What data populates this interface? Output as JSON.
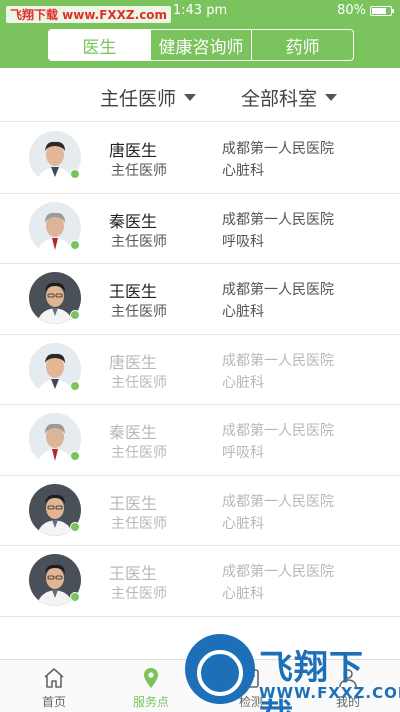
{
  "status_bar": {
    "watermark": "飞翔下载 www.FXXZ.com",
    "time": "1:43 pm",
    "battery": "80%",
    "battery_level": 0.8
  },
  "segments": [
    {
      "label": "医生",
      "active": true
    },
    {
      "label": "健康咨询师",
      "active": false
    },
    {
      "label": "药师",
      "active": false
    }
  ],
  "filters": {
    "title": "主任医师",
    "department": "全部科室"
  },
  "doctors": [
    {
      "name": "唐医生",
      "title": "主任医师",
      "hospital": "成都第一人民医院",
      "department": "心脏科",
      "faded": false
    },
    {
      "name": "秦医生",
      "title": "主任医师",
      "hospital": "成都第一人民医院",
      "department": "呼吸科",
      "faded": false
    },
    {
      "name": "王医生",
      "title": "主任医师",
      "hospital": "成都第一人民医院",
      "department": "心脏科",
      "faded": false
    },
    {
      "name": "唐医生",
      "title": "主任医师",
      "hospital": "成都第一人民医院",
      "department": "心脏科",
      "faded": true
    },
    {
      "name": "秦医生",
      "title": "主任医师",
      "hospital": "成都第一人民医院",
      "department": "呼吸科",
      "faded": true
    },
    {
      "name": "王医生",
      "title": "主任医师",
      "hospital": "成都第一人民医院",
      "department": "心脏科",
      "faded": true
    },
    {
      "name": "王医生",
      "title": "主任医师",
      "hospital": "成都第一人民医院",
      "department": "心脏科",
      "faded": true
    }
  ],
  "tabbar": [
    {
      "label": "首页",
      "icon": "home-icon",
      "active": false
    },
    {
      "label": "服务点",
      "icon": "location-pin-icon",
      "active": true
    },
    {
      "label": "检测",
      "icon": "test-icon",
      "active": false
    },
    {
      "label": "我的",
      "icon": "profile-icon",
      "active": false
    }
  ],
  "overlay_logo": {
    "text": "飞翔下载",
    "url": "WWW.FXXZ.COM"
  },
  "colors": {
    "accent": "#7bc35d",
    "logo_blue": "#1d6fb8",
    "watermark_red": "#e0302a"
  }
}
